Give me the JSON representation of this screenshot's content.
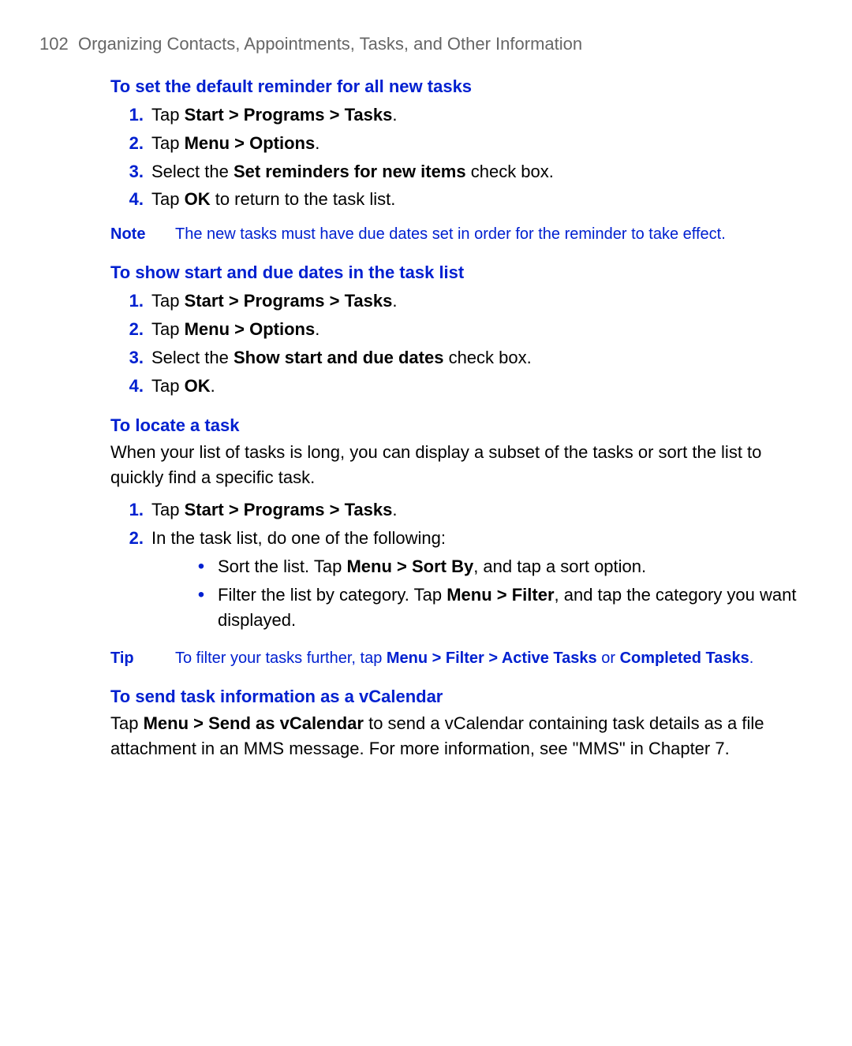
{
  "header": {
    "page_number": "102",
    "chapter_title": "Organizing Contacts, Appointments, Tasks, and Other Information"
  },
  "sections": {
    "s1": {
      "heading": "To set the default reminder for all new tasks",
      "items": {
        "i1": {
          "pre": "Tap ",
          "bold": "Start > Programs > Tasks",
          "post": "."
        },
        "i2": {
          "pre": "Tap ",
          "bold": "Menu > Options",
          "post": "."
        },
        "i3": {
          "pre": "Select the ",
          "bold": "Set reminders for new items",
          "post": " check box."
        },
        "i4": {
          "pre": "Tap ",
          "bold": "OK",
          "post": " to return to the task list."
        }
      },
      "note": {
        "label": "Note",
        "text": "The new tasks must have due dates set in order for the reminder to take effect."
      }
    },
    "s2": {
      "heading": "To show start and due dates in the task list",
      "items": {
        "i1": {
          "pre": "Tap ",
          "bold": "Start > Programs > Tasks",
          "post": "."
        },
        "i2": {
          "pre": "Tap ",
          "bold": "Menu > Options",
          "post": "."
        },
        "i3": {
          "pre": "Select the ",
          "bold": "Show start and due dates",
          "post": " check box."
        },
        "i4": {
          "pre": "Tap ",
          "bold": "OK",
          "post": "."
        }
      }
    },
    "s3": {
      "heading": "To locate a task",
      "intro": "When your list of tasks is long, you can display a subset of the tasks or sort the list to quickly find a specific task.",
      "items": {
        "i1": {
          "pre": "Tap ",
          "bold": "Start > Programs > Tasks",
          "post": "."
        },
        "i2": {
          "text": "In the task list, do one of the following:"
        }
      },
      "bullets": {
        "b1": {
          "pre": "Sort the list. Tap ",
          "bold": "Menu > Sort By",
          "post": ", and tap a sort option."
        },
        "b2": {
          "pre": "Filter the list by category. Tap ",
          "bold": "Menu > Filter",
          "post": ", and tap the category you want displayed."
        }
      },
      "tip": {
        "label": "Tip",
        "pre": "To filter your tasks further, tap ",
        "bold1": "Menu > Filter > Active Tasks",
        "mid": " or ",
        "bold2": "Completed Tasks",
        "post": "."
      }
    },
    "s4": {
      "heading": "To send task information as a vCalendar",
      "para": {
        "pre": "Tap ",
        "bold": "Menu > Send as vCalendar",
        "post": " to send a vCalendar containing task details as a file attachment in an MMS message. For more information, see \"MMS\" in Chapter 7."
      }
    }
  },
  "numbers": {
    "n1": "1.",
    "n2": "2.",
    "n3": "3.",
    "n4": "4."
  },
  "glyphs": {
    "bullet": "•"
  }
}
